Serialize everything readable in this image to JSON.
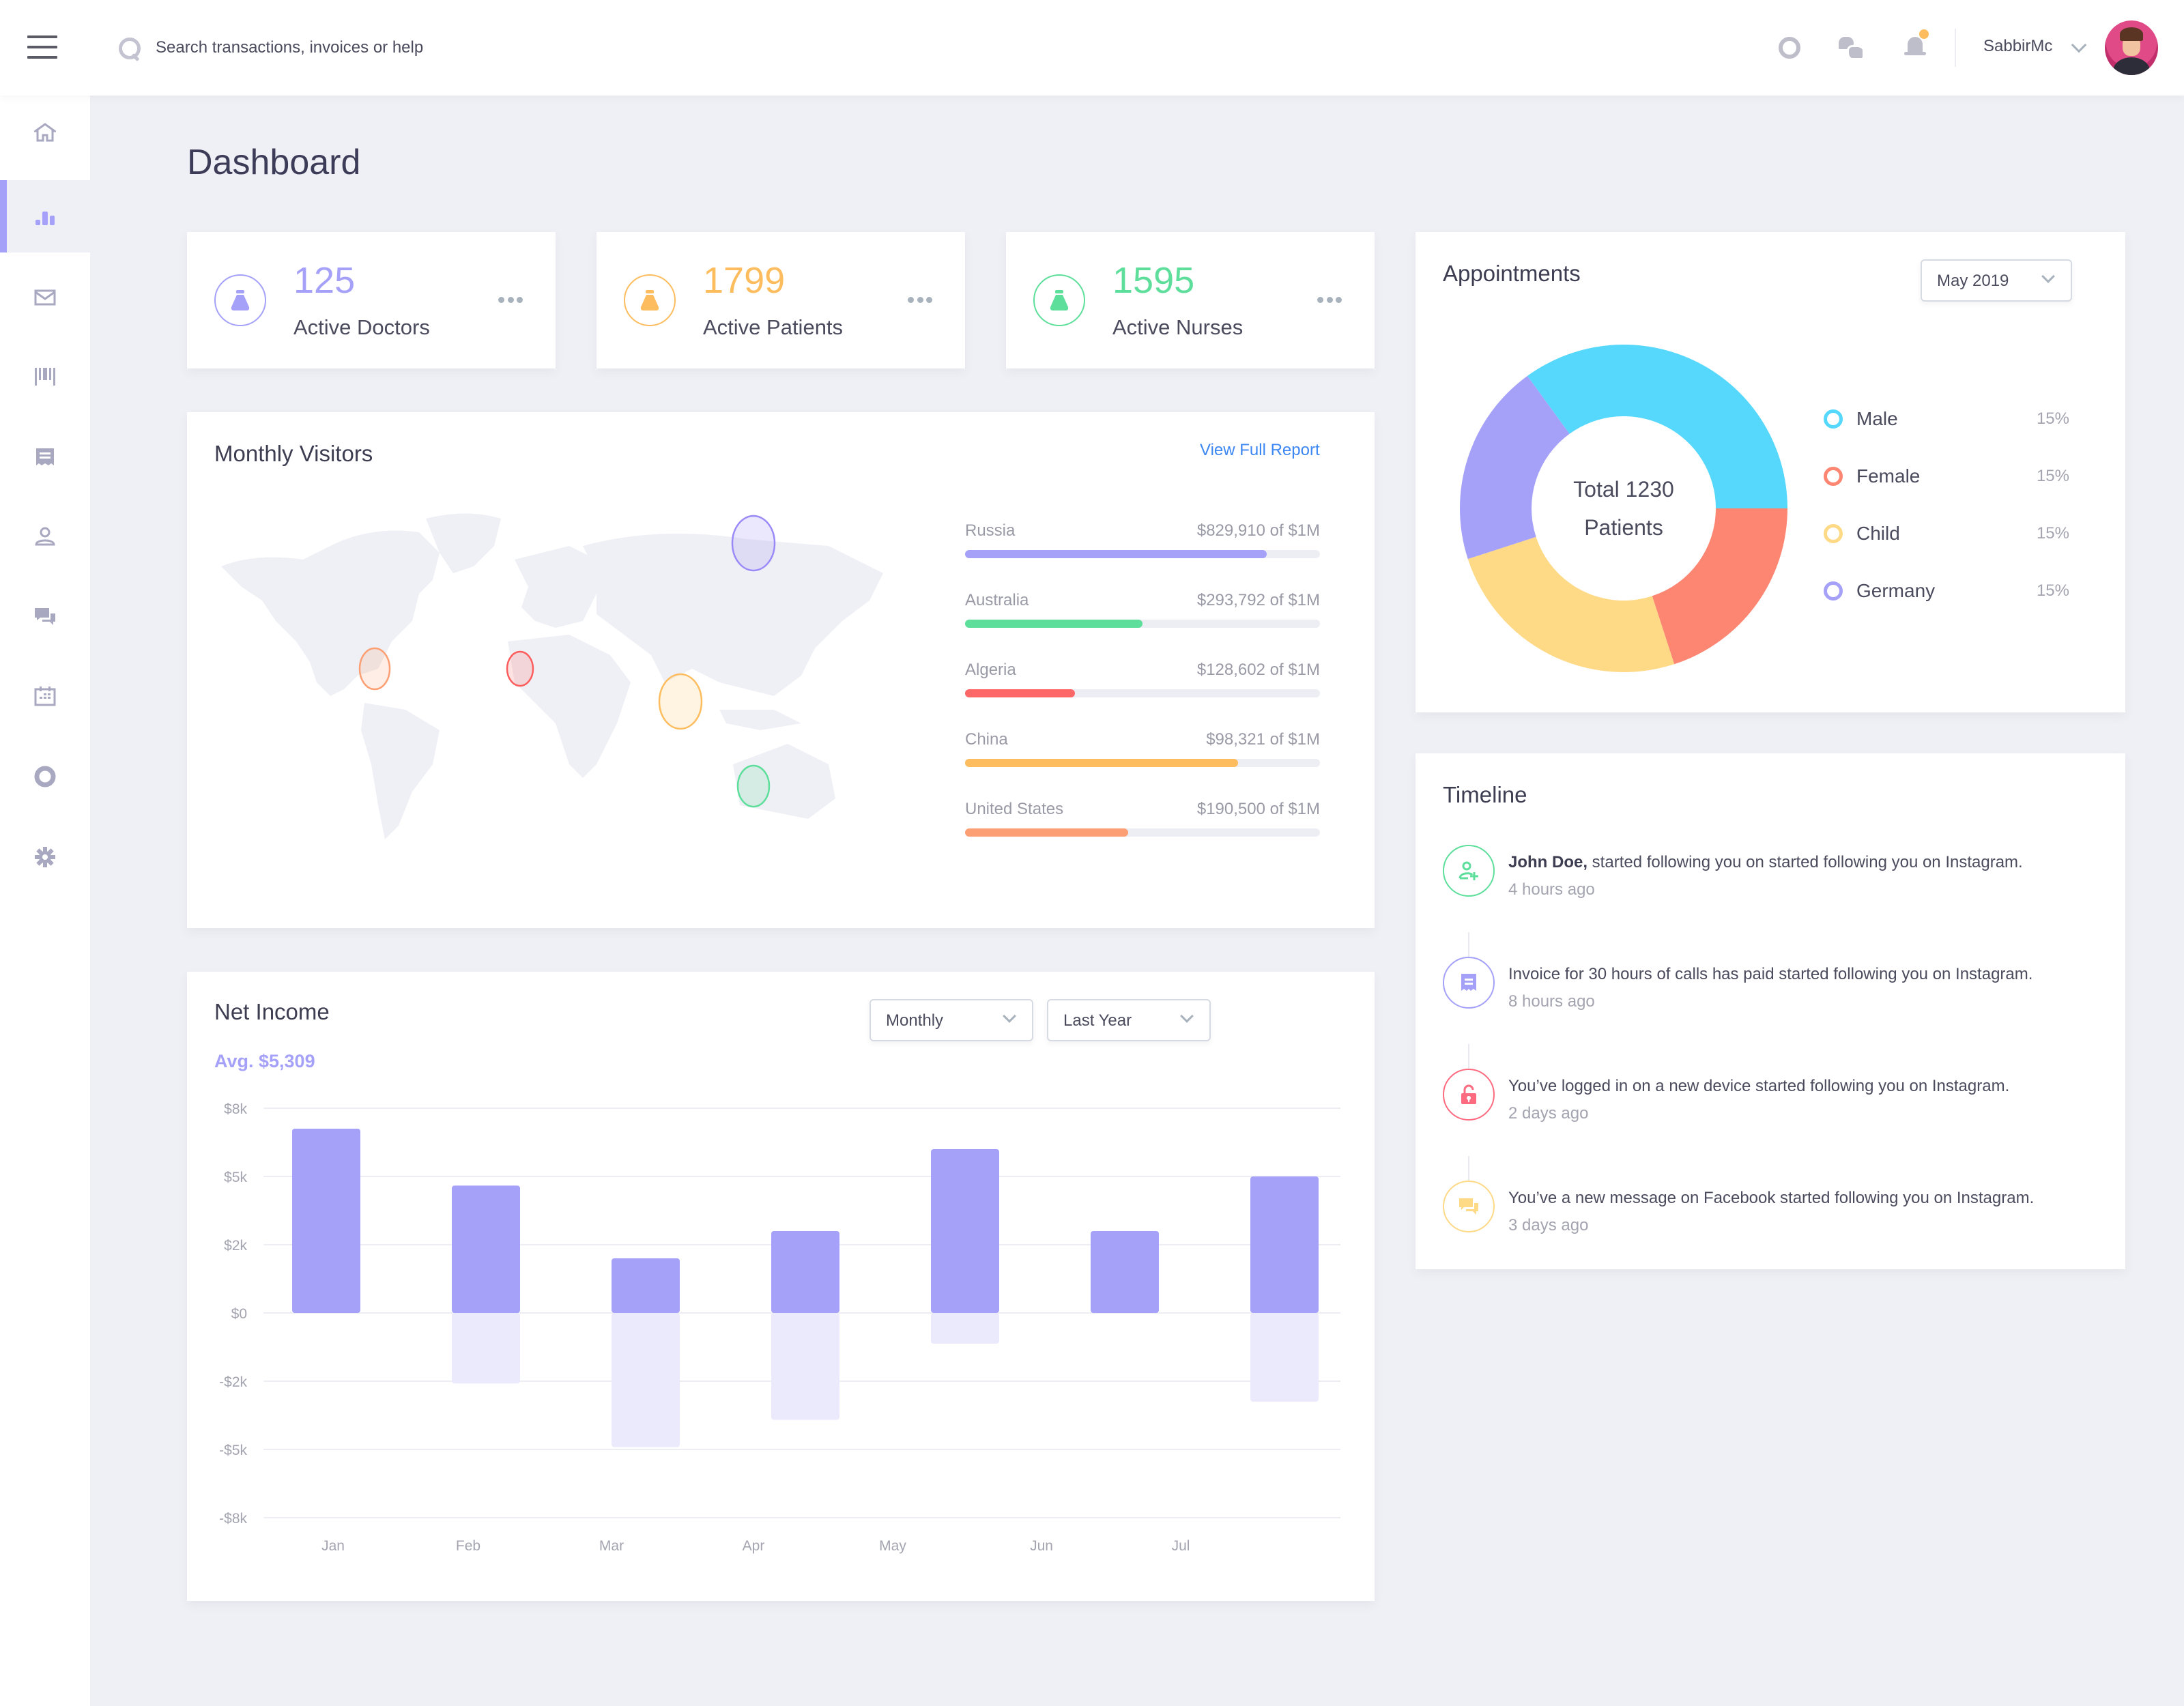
{
  "topbar": {
    "search_placeholder": "Search transactions, invoices or help",
    "icons": [
      "help-icon",
      "chat-icon",
      "bell-icon"
    ],
    "notification_dot_color": "#fdbd5e",
    "user_name": "SabbirMc"
  },
  "sidebar": {
    "active_index": 1,
    "items": [
      {
        "name": "home",
        "icon": "home-icon"
      },
      {
        "name": "analytics",
        "icon": "bar-chart-icon"
      },
      {
        "name": "mail",
        "icon": "mail-icon"
      },
      {
        "name": "barcode",
        "icon": "barcode-icon"
      },
      {
        "name": "invoices",
        "icon": "receipt-icon"
      },
      {
        "name": "users",
        "icon": "user-icon"
      },
      {
        "name": "messages",
        "icon": "chat-icon"
      },
      {
        "name": "calendar",
        "icon": "calendar-icon"
      },
      {
        "name": "support",
        "icon": "lifebuoy-icon"
      },
      {
        "name": "settings",
        "icon": "gear-icon"
      }
    ]
  },
  "page_title": "Dashboard",
  "stats": [
    {
      "value": "125",
      "label": "Active Doctors",
      "color": "#a5a1f9",
      "icon": "flask-icon"
    },
    {
      "value": "1799",
      "label": "Active Patients",
      "color": "#fdbd5e",
      "icon": "flask-icon"
    },
    {
      "value": "1595",
      "label": "Active Nurses",
      "color": "#5ddf9b",
      "icon": "flask-icon"
    }
  ],
  "visitors": {
    "title": "Monthly Visitors",
    "view_report": "View Full Report",
    "countries": [
      {
        "name": "Russia",
        "amount": "$829,910 of $1M",
        "progress": 0.85,
        "color": "#a5a1f9"
      },
      {
        "name": "Australia",
        "amount": "$293,792 of $1M",
        "progress": 0.5,
        "color": "#5ddf9b"
      },
      {
        "name": "Algeria",
        "amount": "$128,602 of $1M",
        "progress": 0.31,
        "color": "#fd6767"
      },
      {
        "name": "China",
        "amount": "$98,321 of $1M",
        "progress": 0.77,
        "color": "#fdbd5e"
      },
      {
        "name": "United States",
        "amount": "$190,500 of $1M",
        "progress": 0.46,
        "color": "#fc9f73"
      }
    ],
    "map_markers": [
      {
        "country": "United States",
        "color": "#fc9f73"
      },
      {
        "country": "Algeria",
        "color": "#fd5d5d"
      },
      {
        "country": "China",
        "color": "#fdbd5e"
      },
      {
        "country": "Russia",
        "color": "#9a8af7"
      },
      {
        "country": "Australia",
        "color": "#5ddf9b"
      }
    ]
  },
  "income": {
    "title": "Net Income",
    "avg": "Avg. $5,309",
    "period_select": "Monthly",
    "range_select": "Last Year"
  },
  "appointments": {
    "title": "Appointments",
    "month_select": "May 2019",
    "center_line1": "Total 1230",
    "center_line2": "Patients",
    "legend": [
      {
        "name": "Male",
        "pct": "15%",
        "color": "#56d8fc"
      },
      {
        "name": "Female",
        "pct": "15%",
        "color": "#fd8672"
      },
      {
        "name": "Child",
        "pct": "15%",
        "color": "#fed986"
      },
      {
        "name": "Germany",
        "pct": "15%",
        "color": "#a5a1f9"
      }
    ]
  },
  "timeline": {
    "title": "Timeline",
    "items": [
      {
        "bold": "John Doe,",
        "text": " started following you on started following you on Instagram.",
        "time": "4 hours ago",
        "color": "#5ddf9b",
        "icon": "add-user-icon"
      },
      {
        "bold": "",
        "text": "Invoice for 30 hours of calls has paid started following you on Instagram.",
        "time": "8 hours ago",
        "color": "#a5a1f9",
        "icon": "receipt-icon"
      },
      {
        "bold": "",
        "text": "You’ve logged in on a new device started following you on Instagram.",
        "time": "2 days ago",
        "color": "#fd6b80",
        "icon": "unlock-icon"
      },
      {
        "bold": "",
        "text": "You’ve a new message on Facebook started following you on Instagram.",
        "time": "3 days ago",
        "color": "#fed986",
        "icon": "chat-icon"
      }
    ]
  },
  "chart_data": [
    {
      "type": "bar",
      "title": "Net Income",
      "subtitle": "Avg. $5,309",
      "categories": [
        "Jan",
        "Feb",
        "Mar",
        "Apr",
        "May",
        "Jun",
        "Jul"
      ],
      "x_tick_labels": [
        "Jan",
        "Feb",
        "Mar",
        "Apr",
        "May",
        "Jun",
        "Jul"
      ],
      "y_tick_labels": [
        "$8k",
        "$5k",
        "$2k",
        "$0",
        "-$2k",
        "-$5k",
        "-$8k"
      ],
      "y_tick_values": [
        8000,
        5000,
        2000,
        0,
        -2000,
        -5000,
        -8000
      ],
      "series": [
        {
          "name": "Income",
          "color": "#a5a1f9",
          "values": [
            7100,
            4600,
            1600,
            2600,
            6200,
            2600,
            5000
          ]
        },
        {
          "name": "Expenses",
          "color": "#ebeafd",
          "values": [
            0,
            -2100,
            -4900,
            -3700,
            -900,
            0,
            -2900
          ]
        }
      ],
      "ylim": [
        -8000,
        8000
      ],
      "grid": true,
      "xlabel": "",
      "ylabel": ""
    },
    {
      "type": "pie",
      "title": "Appointments",
      "center_text": "Total 1230 Patients",
      "labels": [
        "Male",
        "Female",
        "Child",
        "Germany"
      ],
      "values": [
        35,
        20,
        25,
        20
      ],
      "legend_values": [
        "15%",
        "15%",
        "15%",
        "15%"
      ],
      "colors": [
        "#56d8fc",
        "#fd8672",
        "#fed986",
        "#a5a1f9"
      ],
      "legend": "right"
    }
  ]
}
